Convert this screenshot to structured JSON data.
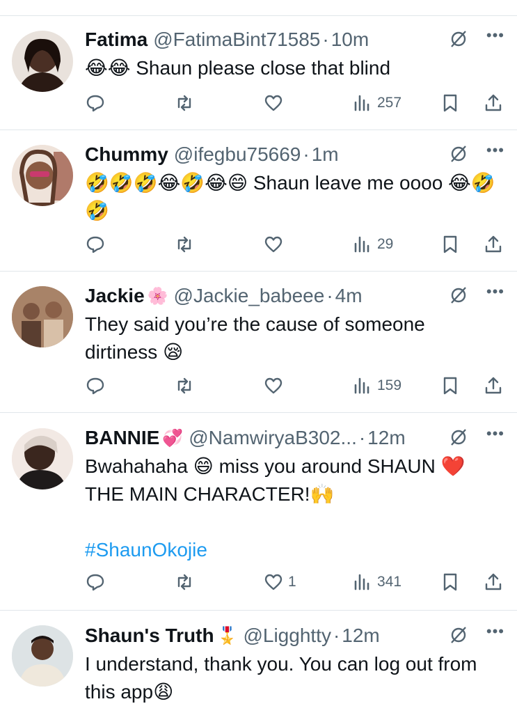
{
  "tweets": [
    {
      "name": "Fatima",
      "badge": "",
      "handle": "@FatimaBint71585",
      "time": "10m",
      "text": "😂😂 Shaun please close that blind",
      "hashtag": "",
      "likes": "",
      "views": "257",
      "avatar_color": "#6b4a3a"
    },
    {
      "name": "Chummy",
      "badge": "",
      "handle": "@ifegbu75669",
      "time": "1m",
      "text": "🤣🤣🤣😂🤣😂😄 Shaun leave me oooo 😂🤣🤣",
      "hashtag": "",
      "likes": "",
      "views": "29",
      "avatar_color": "#c9a08b"
    },
    {
      "name": "Jackie",
      "badge": "🌸",
      "handle": "@Jackie_babeee",
      "time": "4m",
      "text": "They said you’re the cause of someone dirtiness 😪",
      "hashtag": "",
      "likes": "",
      "views": "159",
      "avatar_color": "#9a7a63"
    },
    {
      "name": "BANNIE",
      "badge": "💞",
      "handle": "@NamwiryaB302...",
      "time": "12m",
      "text": "Bwahahaha 😄 miss you around SHAUN ❤️ THE MAIN CHARACTER!🙌",
      "hashtag": "#ShaunOkojie",
      "likes": "1",
      "views": "341",
      "avatar_color": "#3b2a24"
    },
    {
      "name": "Shaun's Truth",
      "badge": "🎖️",
      "handle": "@Ligghtty",
      "time": "12m",
      "text": "I understand, thank you. You can log out from this app😩",
      "hashtag": "",
      "likes": "",
      "views": "",
      "avatar_color": "#e8e1d8"
    }
  ],
  "accent_color": "#1d9bf0",
  "icons": [
    "reply-icon",
    "retweet-icon",
    "like-icon",
    "views-icon",
    "bookmark-icon",
    "share-icon",
    "grok-icon",
    "more-icon"
  ]
}
